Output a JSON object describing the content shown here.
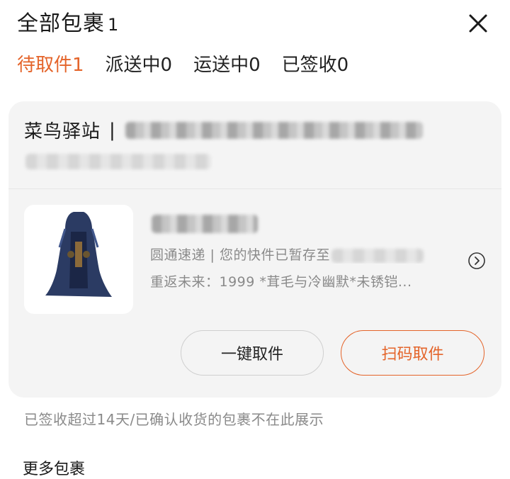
{
  "header": {
    "title": "全部包裹",
    "count": "1"
  },
  "tabs": [
    {
      "label": "待取件1",
      "active": true
    },
    {
      "label": "派送中0",
      "active": false
    },
    {
      "label": "运送中0",
      "active": false
    },
    {
      "label": "已签收0",
      "active": false
    }
  ],
  "card": {
    "station_name": "菜鸟驿站",
    "separator": "|",
    "courier_line_prefix": "圆通速递 | 您的快件已暂存至",
    "item_line": "重返未来：1999 *茸毛与冷幽默*未锈铠...",
    "buttons": {
      "one_click": "一键取件",
      "scan": "扫码取件"
    }
  },
  "note": "已签收超过14天/已确认收货的包裹不在此展示",
  "more_label": "更多包裹",
  "colors": {
    "accent": "#e4642a",
    "card_bg": "#f4f4f4",
    "muted_text": "#8a8a8a"
  },
  "icons": {
    "close": "close-icon",
    "chevron": "chevron-right-circle-icon",
    "product": "robe-figure-image"
  }
}
